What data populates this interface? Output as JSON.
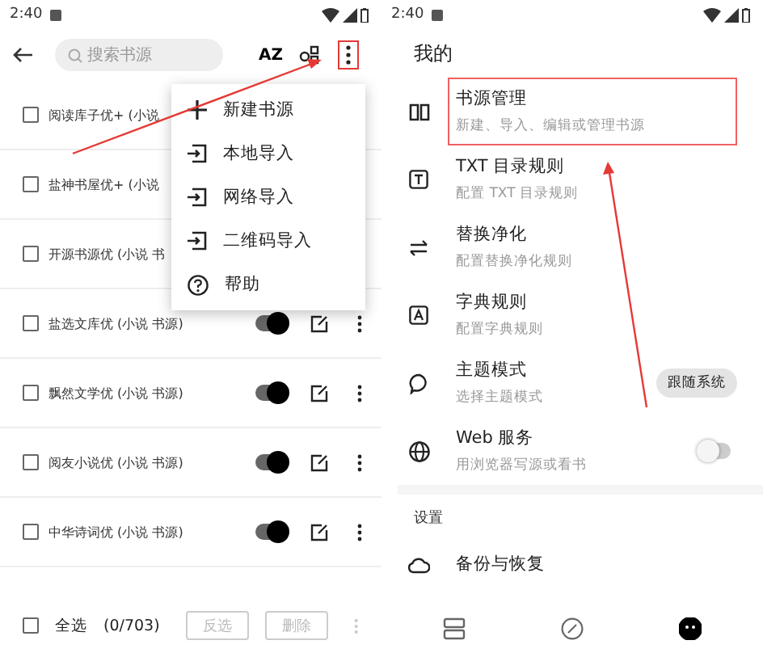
{
  "left_screen": {
    "status_bar": {
      "time": "2:40"
    },
    "toolbar": {
      "search": {
        "placeholder": "搜索书源"
      },
      "sort_label": "AZ",
      "more_highlighted": true
    },
    "sources": [
      {
        "name": "阅读库子优+ (小说",
        "checked": false
      },
      {
        "name": "盐神书屋优+ (小说",
        "checked": false
      },
      {
        "name": "开源书源优 (小说 书",
        "checked": false
      },
      {
        "name": "盐选文库优 (小说 书源)",
        "checked": false,
        "enabled": true
      },
      {
        "name": "飘然文学优 (小说 书源)",
        "checked": false,
        "enabled": true
      },
      {
        "name": "阅友小说优 (小说 书源)",
        "checked": false,
        "enabled": true
      },
      {
        "name": "中华诗词优 (小说 书源)",
        "checked": false,
        "enabled": true
      }
    ],
    "menu": [
      {
        "kind": "add",
        "label": "新建书源"
      },
      {
        "kind": "import",
        "label": "本地导入"
      },
      {
        "kind": "import",
        "label": "网络导入"
      },
      {
        "kind": "import",
        "label": "二维码导入"
      },
      {
        "kind": "help",
        "label": "帮助"
      }
    ],
    "bottom_bar": {
      "checked": false,
      "select_all": "全选",
      "count": "(0/703)",
      "buttons": [
        {
          "label": "反选",
          "disabled": true
        },
        {
          "label": "删除",
          "disabled": true
        }
      ]
    }
  },
  "right_screen": {
    "status_bar": {
      "time": "2:40"
    },
    "title": "我的",
    "items": [
      {
        "kind": "book",
        "title": "书源管理",
        "subtitle": "新建、导入、编辑或管理书源",
        "highlighted": true
      },
      {
        "kind": "txt",
        "title": "TXT 目录规则",
        "subtitle": "配置 TXT 目录规则",
        "highlighted": false
      },
      {
        "kind": "replace",
        "title": "替换净化",
        "subtitle": "配置替换净化规则",
        "highlighted": false
      },
      {
        "kind": "dict",
        "title": "字典规则",
        "subtitle": "配置字典规则",
        "highlighted": false
      },
      {
        "kind": "theme",
        "title": "主题模式",
        "subtitle": "选择主题模式",
        "highlighted": false,
        "chip": "跟随系统"
      },
      {
        "kind": "web",
        "title": "Web 服务",
        "subtitle": "用浏览器写源或看书",
        "highlighted": false,
        "on": false
      }
    ],
    "section": "设置",
    "settings": [
      {
        "kind": "cloud",
        "title": "备份与恢复"
      }
    ],
    "nav": [
      {
        "kind": "shelf",
        "selected": false
      },
      {
        "kind": "explore",
        "selected": false
      },
      {
        "kind": "my",
        "selected": true
      }
    ]
  }
}
